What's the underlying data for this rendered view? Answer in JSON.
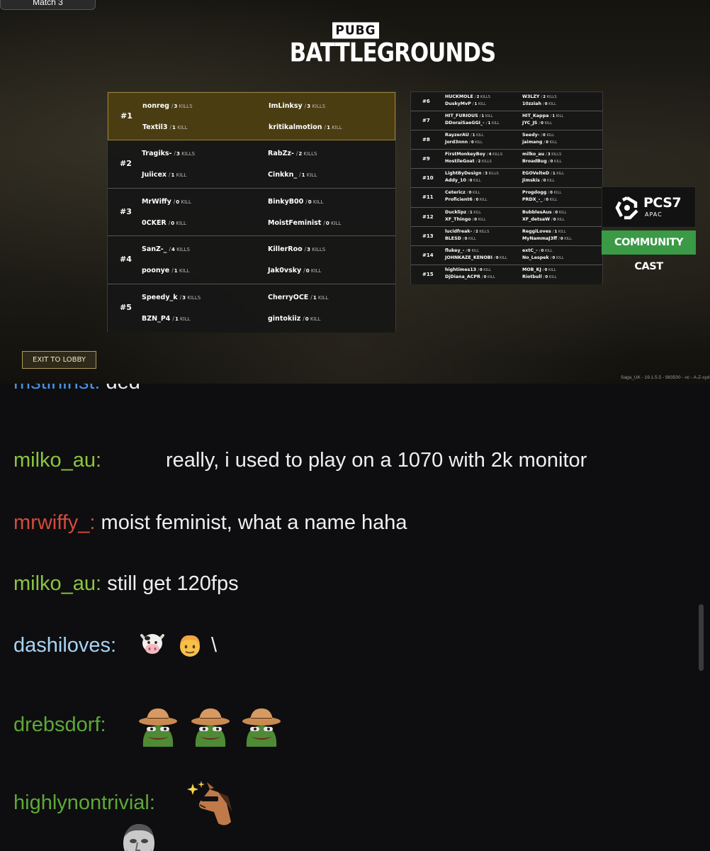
{
  "stream": {
    "match_tab": "Match 3",
    "logo_top": "PUBG",
    "logo_bottom": "BATTLEGROUNDS",
    "exit_button": "EXIT TO LOBBY",
    "build_info": "Saga_UK - 19.1.5.5 - 983500 - oc - A-Z-syd",
    "kill_label_single": "KILL",
    "kill_label_plural": "KILLS",
    "badge": {
      "name": "PCS7",
      "region": "APAC",
      "subtitle": "COMMUNITY CAST",
      "accent": "#3a9a45"
    },
    "leaderboard_top": [
      {
        "rank": "#1",
        "highlight": true,
        "players": [
          {
            "name": "nonreg",
            "kills": "3",
            "unit": "KILLS"
          },
          {
            "name": "ImLinksy",
            "kills": "3",
            "unit": "KILLS"
          },
          {
            "name": "Textil3",
            "kills": "1",
            "unit": "KILL"
          },
          {
            "name": "kritikalmotion",
            "kills": "1",
            "unit": "KILL"
          }
        ]
      },
      {
        "rank": "#2",
        "highlight": false,
        "players": [
          {
            "name": "Tragiks-",
            "kills": "3",
            "unit": "KILLS"
          },
          {
            "name": "RabZz-",
            "kills": "2",
            "unit": "KILLS"
          },
          {
            "name": "Juiicex",
            "kills": "1",
            "unit": "KILL"
          },
          {
            "name": "Cinkkn_",
            "kills": "1",
            "unit": "KILL"
          }
        ]
      },
      {
        "rank": "#3",
        "highlight": false,
        "players": [
          {
            "name": "MrWiffy",
            "kills": "0",
            "unit": "KILL"
          },
          {
            "name": "BinkyB00",
            "kills": "0",
            "unit": "KILL"
          },
          {
            "name": "0CKER",
            "kills": "0",
            "unit": "KILL"
          },
          {
            "name": "MoistFeminist",
            "kills": "0",
            "unit": "KILL"
          }
        ]
      },
      {
        "rank": "#4",
        "highlight": false,
        "players": [
          {
            "name": "SanZ-_",
            "kills": "4",
            "unit": "KILLS"
          },
          {
            "name": "KillerRoo",
            "kills": "3",
            "unit": "KILLS"
          },
          {
            "name": "poonye",
            "kills": "1",
            "unit": "KILL"
          },
          {
            "name": "Jak0vsky",
            "kills": "0",
            "unit": "KILL"
          }
        ]
      },
      {
        "rank": "#5",
        "highlight": false,
        "players": [
          {
            "name": "Speedy_k",
            "kills": "3",
            "unit": "KILLS"
          },
          {
            "name": "CherryOCE",
            "kills": "1",
            "unit": "KILL"
          },
          {
            "name": "BZN_P4",
            "kills": "1",
            "unit": "KILL"
          },
          {
            "name": "gintokiiz",
            "kills": "0",
            "unit": "KILL"
          }
        ]
      }
    ],
    "leaderboard_rest": [
      {
        "rank": "#6",
        "players": [
          {
            "name": "HUCKMOLE",
            "kills": "2",
            "unit": "KILLS"
          },
          {
            "name": "W3LZY",
            "kills": "2",
            "unit": "KILLS"
          },
          {
            "name": "DuskyMvP",
            "kills": "1",
            "unit": "KILL"
          },
          {
            "name": "10zziah",
            "kills": "0",
            "unit": "KILL"
          }
        ]
      },
      {
        "rank": "#7",
        "players": [
          {
            "name": "HIT_FURIOUS",
            "kills": "1",
            "unit": "KILL"
          },
          {
            "name": "HIT_Kappa",
            "kills": "1",
            "unit": "KILL"
          },
          {
            "name": "DDoraiSaeGGI_-",
            "kills": "1",
            "unit": "KILL"
          },
          {
            "name": "JYC_JS",
            "kills": "0",
            "unit": "KILL"
          }
        ]
      },
      {
        "rank": "#8",
        "players": [
          {
            "name": "RayzerAU",
            "kills": "1",
            "unit": "KILL"
          },
          {
            "name": "Seedy-",
            "kills": "0",
            "unit": "KILL"
          },
          {
            "name": "Jord3nnn",
            "kills": "0",
            "unit": "KILL"
          },
          {
            "name": "jaimang",
            "kills": "0",
            "unit": "KILL"
          }
        ]
      },
      {
        "rank": "#9",
        "players": [
          {
            "name": "FirstMonkeyBoy",
            "kills": "4",
            "unit": "KILLS"
          },
          {
            "name": "milko_au",
            "kills": "3",
            "unit": "KILLS"
          },
          {
            "name": "HostileGoat",
            "kills": "2",
            "unit": "KILLS"
          },
          {
            "name": "BroadBug",
            "kills": "0",
            "unit": "KILL"
          }
        ]
      },
      {
        "rank": "#10",
        "players": [
          {
            "name": "LightByDesign",
            "kills": "3",
            "unit": "KILLS"
          },
          {
            "name": "EGOVelteD",
            "kills": "1",
            "unit": "KILL"
          },
          {
            "name": "Addy_10",
            "kills": "0",
            "unit": "KILL"
          },
          {
            "name": "Jimskis",
            "kills": "0",
            "unit": "KILL"
          }
        ]
      },
      {
        "rank": "#11",
        "players": [
          {
            "name": "Cetericz",
            "kills": "0",
            "unit": "KILL"
          },
          {
            "name": "Progdogg",
            "kills": "0",
            "unit": "KILL"
          },
          {
            "name": "Proficient6",
            "kills": "0",
            "unit": "KILL"
          },
          {
            "name": "PRDX_-_",
            "kills": "0",
            "unit": "KILL"
          }
        ]
      },
      {
        "rank": "#12",
        "players": [
          {
            "name": "Ducklipz",
            "kills": "1",
            "unit": "KILL"
          },
          {
            "name": "BubblesAus",
            "kills": "0",
            "unit": "KILL"
          },
          {
            "name": "XF_Thingo",
            "kills": "0",
            "unit": "KILL"
          },
          {
            "name": "XF_detsaW",
            "kills": "0",
            "unit": "KILL"
          }
        ]
      },
      {
        "rank": "#13",
        "players": [
          {
            "name": "lucidfreak-",
            "kills": "2",
            "unit": "KILLS"
          },
          {
            "name": "ReggiLoves",
            "kills": "1",
            "unit": "KILL"
          },
          {
            "name": "BLESD",
            "kills": "0",
            "unit": "KILL"
          },
          {
            "name": "MyNammaJ3ff",
            "kills": "0",
            "unit": "KILL"
          }
        ]
      },
      {
        "rank": "#14",
        "players": [
          {
            "name": "flukey_-",
            "kills": "0",
            "unit": "KILL"
          },
          {
            "name": "extC_-",
            "kills": "0",
            "unit": "KILL"
          },
          {
            "name": "JOHNKAZE_KENOBI",
            "kills": "0",
            "unit": "KILL"
          },
          {
            "name": "No_Lespek",
            "kills": "0",
            "unit": "KILL"
          }
        ]
      },
      {
        "rank": "#15",
        "players": [
          {
            "name": "hightimes13",
            "kills": "0",
            "unit": "KILL"
          },
          {
            "name": "MOB_KJ",
            "kills": "0",
            "unit": "KILL"
          },
          {
            "name": "DjDiana_ACPR",
            "kills": "0",
            "unit": "KILL"
          },
          {
            "name": "Riotbull",
            "kills": "0",
            "unit": "KILL"
          }
        ]
      }
    ]
  },
  "chat": {
    "messages": [
      {
        "user": "mstininst:",
        "text": "ded",
        "color": "#4a90e2"
      },
      {
        "user": "milko_au:",
        "text": "really, i used to play on a 1070 with 2k monitor",
        "color": "#8dc43f",
        "emote": "face-emote"
      },
      {
        "user": "mrwiffy_:",
        "text": "moist feminist, what a name haha",
        "color": "#d24b3d"
      },
      {
        "user": "milko_au:",
        "text": "still get 120fps",
        "color": "#8dc43f"
      },
      {
        "user": "dashiloves:",
        "text": "\\",
        "color": "#a8d4f2",
        "emote": "cow-emoji boy-emoji"
      },
      {
        "user": "drebsdorf:",
        "text": "",
        "color": "#5ea838",
        "emote": "cowboy-frog-emote x3"
      },
      {
        "user": "highlynontrivial:",
        "text": "",
        "color": "#5ea838",
        "emote": "horse-sparkle-emote"
      }
    ]
  }
}
